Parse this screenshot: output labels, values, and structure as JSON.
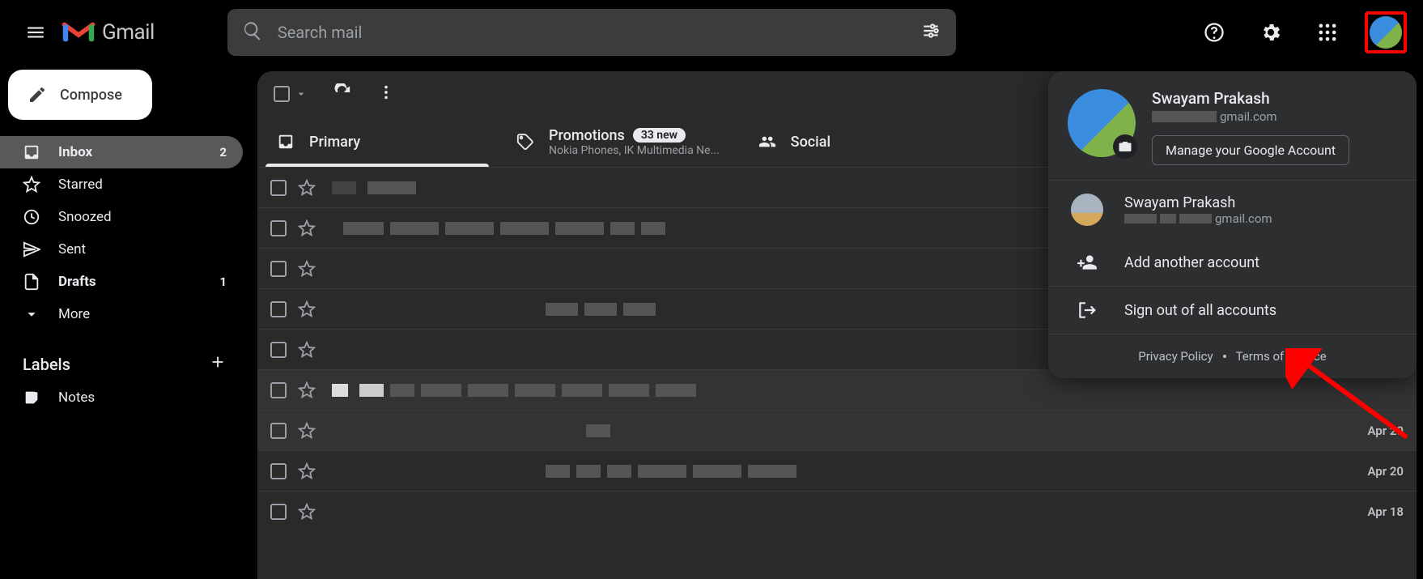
{
  "header": {
    "app_name": "Gmail",
    "search_placeholder": "Search mail"
  },
  "compose_label": "Compose",
  "sidebar": {
    "items": [
      {
        "label": "Inbox",
        "count": "2"
      },
      {
        "label": "Starred",
        "count": ""
      },
      {
        "label": "Snoozed",
        "count": ""
      },
      {
        "label": "Sent",
        "count": ""
      },
      {
        "label": "Drafts",
        "count": "1"
      },
      {
        "label": "More",
        "count": ""
      }
    ],
    "labels_header": "Labels",
    "labels": [
      {
        "label": "Notes"
      }
    ]
  },
  "tabs": {
    "primary": {
      "label": "Primary"
    },
    "promotions": {
      "label": "Promotions",
      "badge": "33 new",
      "sub": "Nokia Phones, IK Multimedia Ne..."
    },
    "social": {
      "label": "Social"
    }
  },
  "mail_dates": {
    "d1": "Apr 20",
    "d2": "Apr 20",
    "d3": "Apr 18"
  },
  "popover": {
    "primary_name": "Swayam Prakash",
    "primary_suffix": "gmail.com",
    "manage": "Manage your Google Account",
    "alt_name": "Swayam Prakash",
    "alt_suffix": "gmail.com",
    "add": "Add another account",
    "signout": "Sign out of all accounts",
    "privacy": "Privacy Policy",
    "tos": "Terms of Service"
  }
}
